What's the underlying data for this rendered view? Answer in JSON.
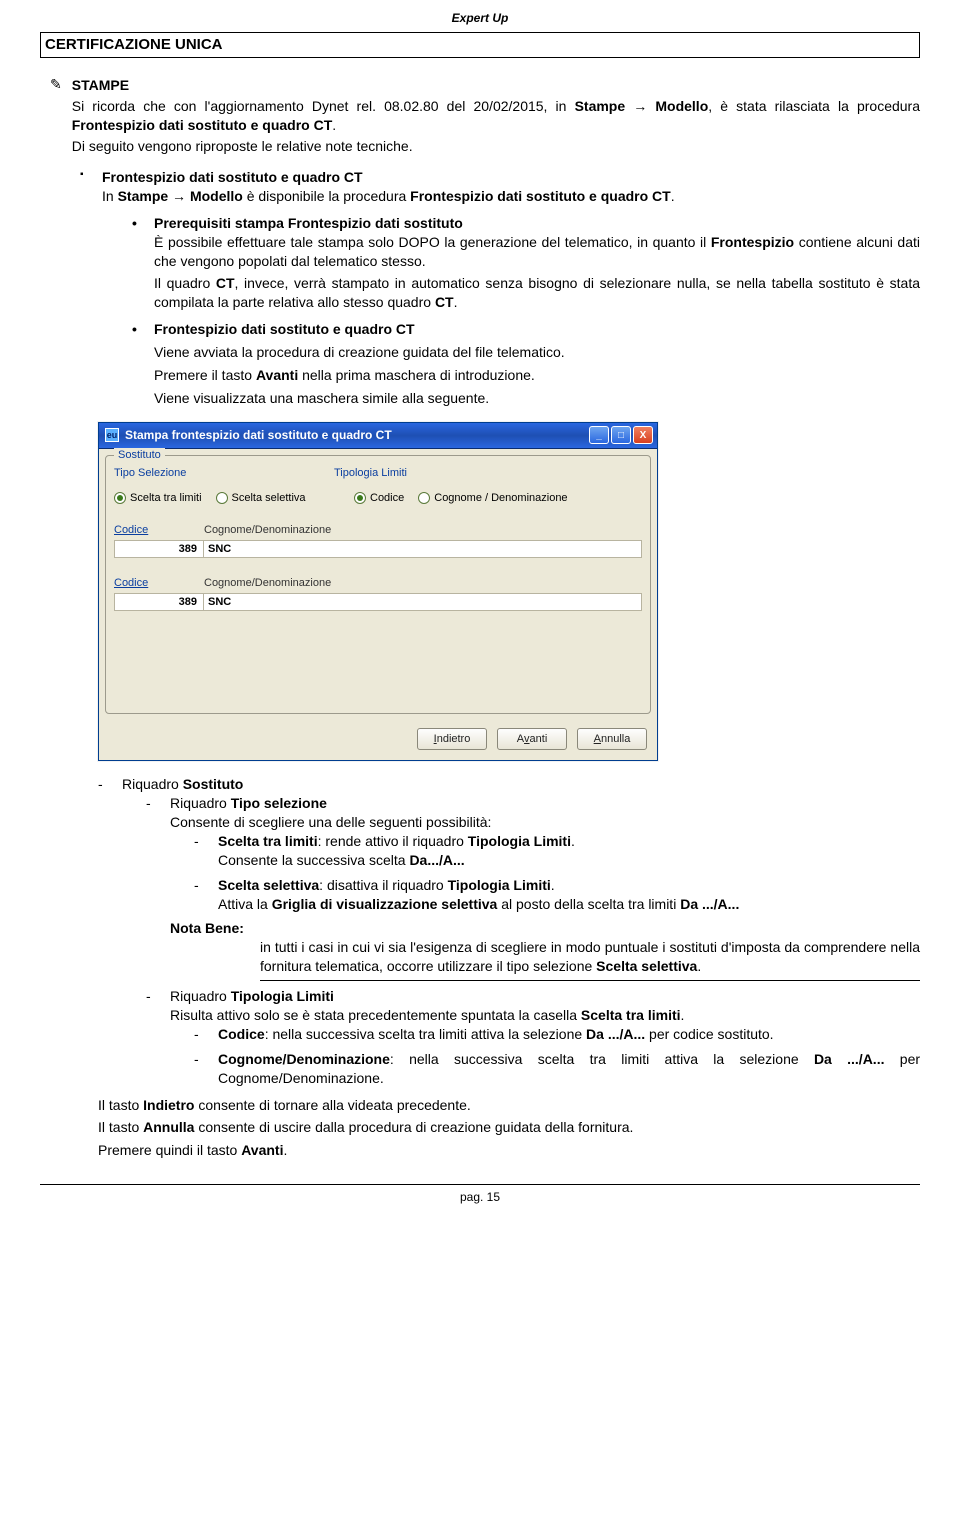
{
  "header": {
    "product": "Expert Up"
  },
  "section": {
    "title": "CERTIFICAZIONE UNICA"
  },
  "stampe": {
    "heading": "STAMPE",
    "intro_part1": "Si ricorda che con l'aggiornamento Dynet rel. 08.02.80 del 20/02/2015, in ",
    "intro_bold1": "Stampe",
    "intro_arrow1": " → ",
    "intro_bold2": "Modello",
    "intro_part2": ", è stata rilasciata la procedura ",
    "intro_bold3": "Frontespizio dati sostituto e quadro CT",
    "intro_part3": ".",
    "note": "Di seguito vengono riproposte le relative note tecniche."
  },
  "sq1": {
    "title": "Frontespizio dati sostituto e quadro CT",
    "p_a": "In ",
    "p_b": "Stampe",
    "p_c": " → ",
    "p_d": "Modello",
    "p_e": " è disponibile la procedura ",
    "p_f": "Frontespizio dati sostituto e quadro CT",
    "p_g": "."
  },
  "dot1": {
    "title": "Prerequisiti stampa Frontespizio dati sostituto",
    "p1_a": "È possibile effettuare tale stampa solo DOPO la generazione del telematico, in quanto il ",
    "p1_b": "Frontespizio",
    "p1_c": " contiene alcuni dati che vengono popolati dal telematico stesso.",
    "p2_a": "Il quadro ",
    "p2_b": "CT",
    "p2_c": ", invece, verrà stampato in automatico senza bisogno di selezionare nulla, se nella tabella sostituto è stata compilata la parte relativa allo stesso quadro ",
    "p2_d": "CT",
    "p2_e": "."
  },
  "dot2": {
    "title": "Frontespizio dati sostituto e quadro CT",
    "p1": "Viene avviata la procedura di creazione guidata del file telematico.",
    "p2_a": "Premere il tasto ",
    "p2_b": "Avanti",
    "p2_c": " nella prima maschera di introduzione.",
    "p3": "Viene visualizzata una maschera simile alla seguente."
  },
  "dialog": {
    "title": "Stampa frontespizio dati sostituto e quadro CT",
    "app_icon_text": "eu",
    "groupbox": "Sostituto",
    "col_tipo": "Tipo Selezione",
    "col_tipologia": "Tipologia Limiti",
    "radio_scelta_limiti": "Scelta tra limiti",
    "radio_scelta_selettiva": "Scelta selettiva",
    "radio_codice": "Codice",
    "radio_cognome": "Cognome / Denominazione",
    "h_codice": "Codice",
    "h_cognome": "Cognome/Denominazione",
    "val_codice": "389",
    "val_cognome": "SNC",
    "btn_indietro": "Indietro",
    "btn_avanti": "Avanti",
    "btn_annulla": "Annulla"
  },
  "lower": {
    "riq_sostituto": "Riquadro ",
    "riq_sostituto_b": "Sostituto",
    "riq_tiposel": "Riquadro ",
    "riq_tiposel_b": "Tipo selezione",
    "tiposel_desc": "Consente di scegliere una delle seguenti possibilità:",
    "op1_b": "Scelta tra limiti",
    "op1_t1": ": rende attivo il riquadro ",
    "op1_b2": "Tipologia Limiti",
    "op1_t2": ".",
    "op1_line2_a": "Consente la successiva scelta ",
    "op1_line2_b": "Da.../A...",
    "op2_b": "Scelta selettiva",
    "op2_t1": ": disattiva il riquadro ",
    "op2_b2": "Tipologia Limiti",
    "op2_t2": ".",
    "op2_line2_a": "Attiva la ",
    "op2_line2_b": "Griglia di visualizzazione selettiva",
    "op2_line2_c": " al posto della scelta tra limiti ",
    "op2_line2_d": "Da .../A...",
    "nota_label": "Nota Bene:",
    "nota_body_a": "in tutti i casi in cui vi sia l'esigenza di scegliere in modo puntuale i sostituti d'imposta da comprendere nella fornitura telematica, occorre utilizzare il tipo selezione ",
    "nota_body_b": "Scelta selettiva",
    "nota_body_c": ".",
    "riq_tiplim": "Riquadro ",
    "riq_tiplim_b": "Tipologia Limiti",
    "tiplim_desc_a": "Risulta attivo solo se è stata precedentemente spuntata la casella ",
    "tiplim_desc_b": "Scelta tra limiti",
    "tiplim_desc_c": ".",
    "tl1_b": "Codice",
    "tl1_t1": ": nella successiva scelta tra limiti attiva la selezione ",
    "tl1_b2": "Da .../A...",
    "tl1_t2": " per codice sostituto.",
    "tl2_b": "Cognome/Denominazione",
    "tl2_t1": ": nella successiva scelta tra limiti attiva la selezione ",
    "tl2_b2": "Da .../A...",
    "tl2_t2": " per Cognome/Denominazione.",
    "t_indietro_a": "Il tasto ",
    "t_indietro_b": "Indietro",
    "t_indietro_c": " consente di tornare alla videata precedente.",
    "t_annulla_a": "Il tasto ",
    "t_annulla_b": "Annulla",
    "t_annulla_c": " consente di uscire dalla procedura di creazione guidata della fornitura.",
    "t_avanti_a": "Premere quindi il tasto ",
    "t_avanti_b": "Avanti",
    "t_avanti_c": "."
  },
  "footer": {
    "page": "pag. 15"
  }
}
